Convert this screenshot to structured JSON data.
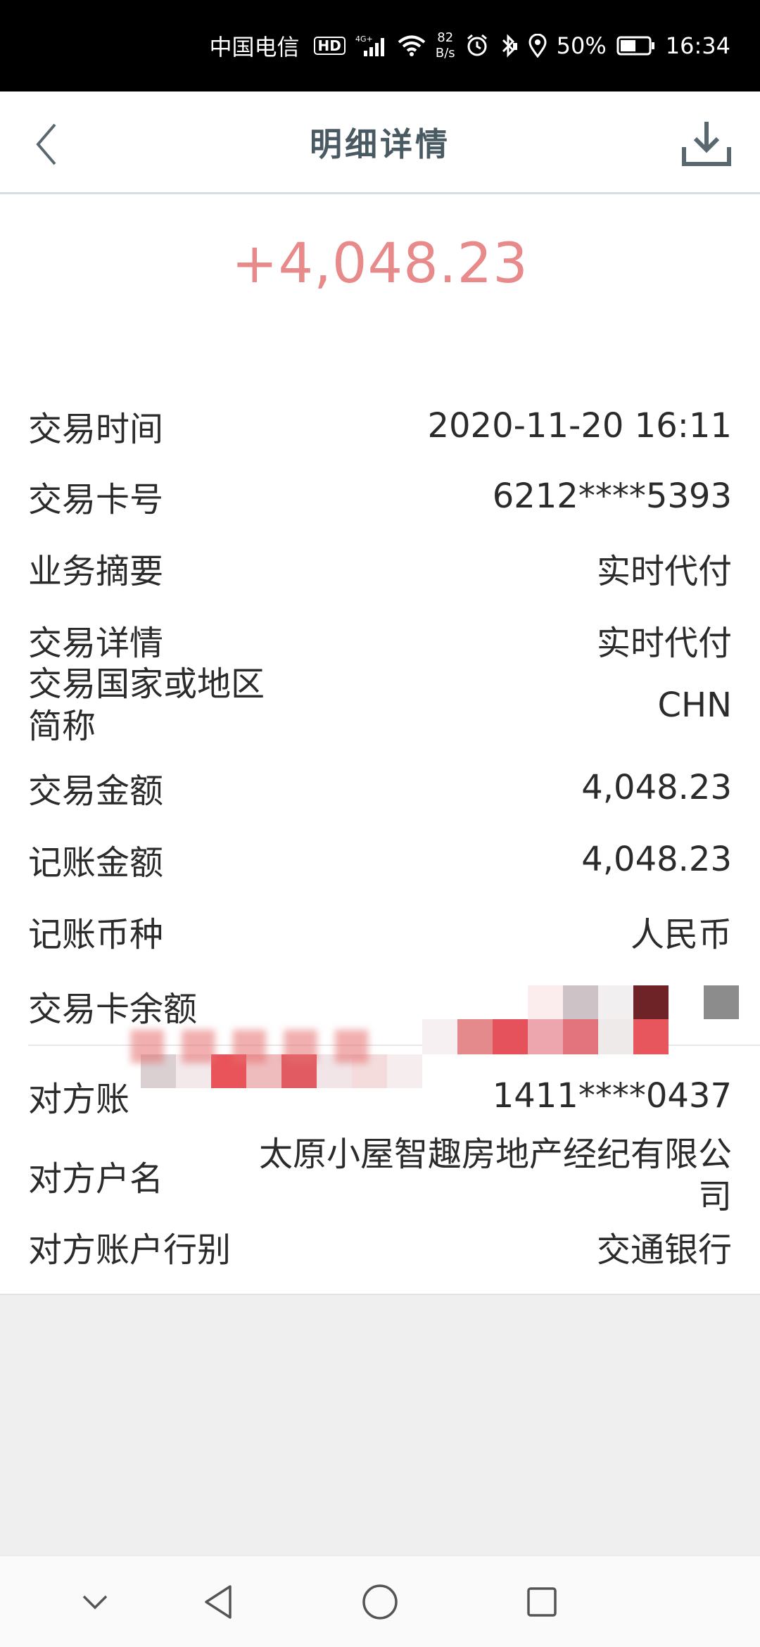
{
  "status_bar": {
    "carrier": "中国电信",
    "hd": "HD",
    "net_rate_value": "82",
    "net_rate_unit": "B/s",
    "battery_percent": "50%",
    "time": "16:34"
  },
  "header": {
    "title": "明细详情"
  },
  "amount": "+4,048.23",
  "details": [
    {
      "label": "交易时间",
      "value": "2020-11-20 16:11"
    },
    {
      "label": "交易卡号",
      "value": "6212****5393"
    },
    {
      "label": "业务摘要",
      "value": "实时代付"
    },
    {
      "label": "交易详情",
      "value": "实时代付"
    },
    {
      "label": "交易国家或地区简称",
      "value": "CHN"
    },
    {
      "label": "交易金额",
      "value": "4,048.23"
    },
    {
      "label": "记账金额",
      "value": "4,048.23"
    },
    {
      "label": "记账币种",
      "value": "人民币"
    },
    {
      "label": "交易卡余额",
      "value": ""
    },
    {
      "label": "对方账",
      "value": "1411****0437"
    },
    {
      "label": "对方户名",
      "value": "太原小屋智趣房地产经纪有限公司"
    },
    {
      "label": "对方账户行别",
      "value": "交通银行"
    }
  ],
  "colors": {
    "amount": "#e8898a",
    "title": "#4a5a63",
    "status_bar_bg": "#000000"
  },
  "icons": {
    "back": "chevron-left-icon",
    "download": "download-icon",
    "nav_down": "chevron-down-icon",
    "nav_back": "triangle-back-icon",
    "nav_home": "circle-home-icon",
    "nav_recents": "square-recents-icon"
  }
}
